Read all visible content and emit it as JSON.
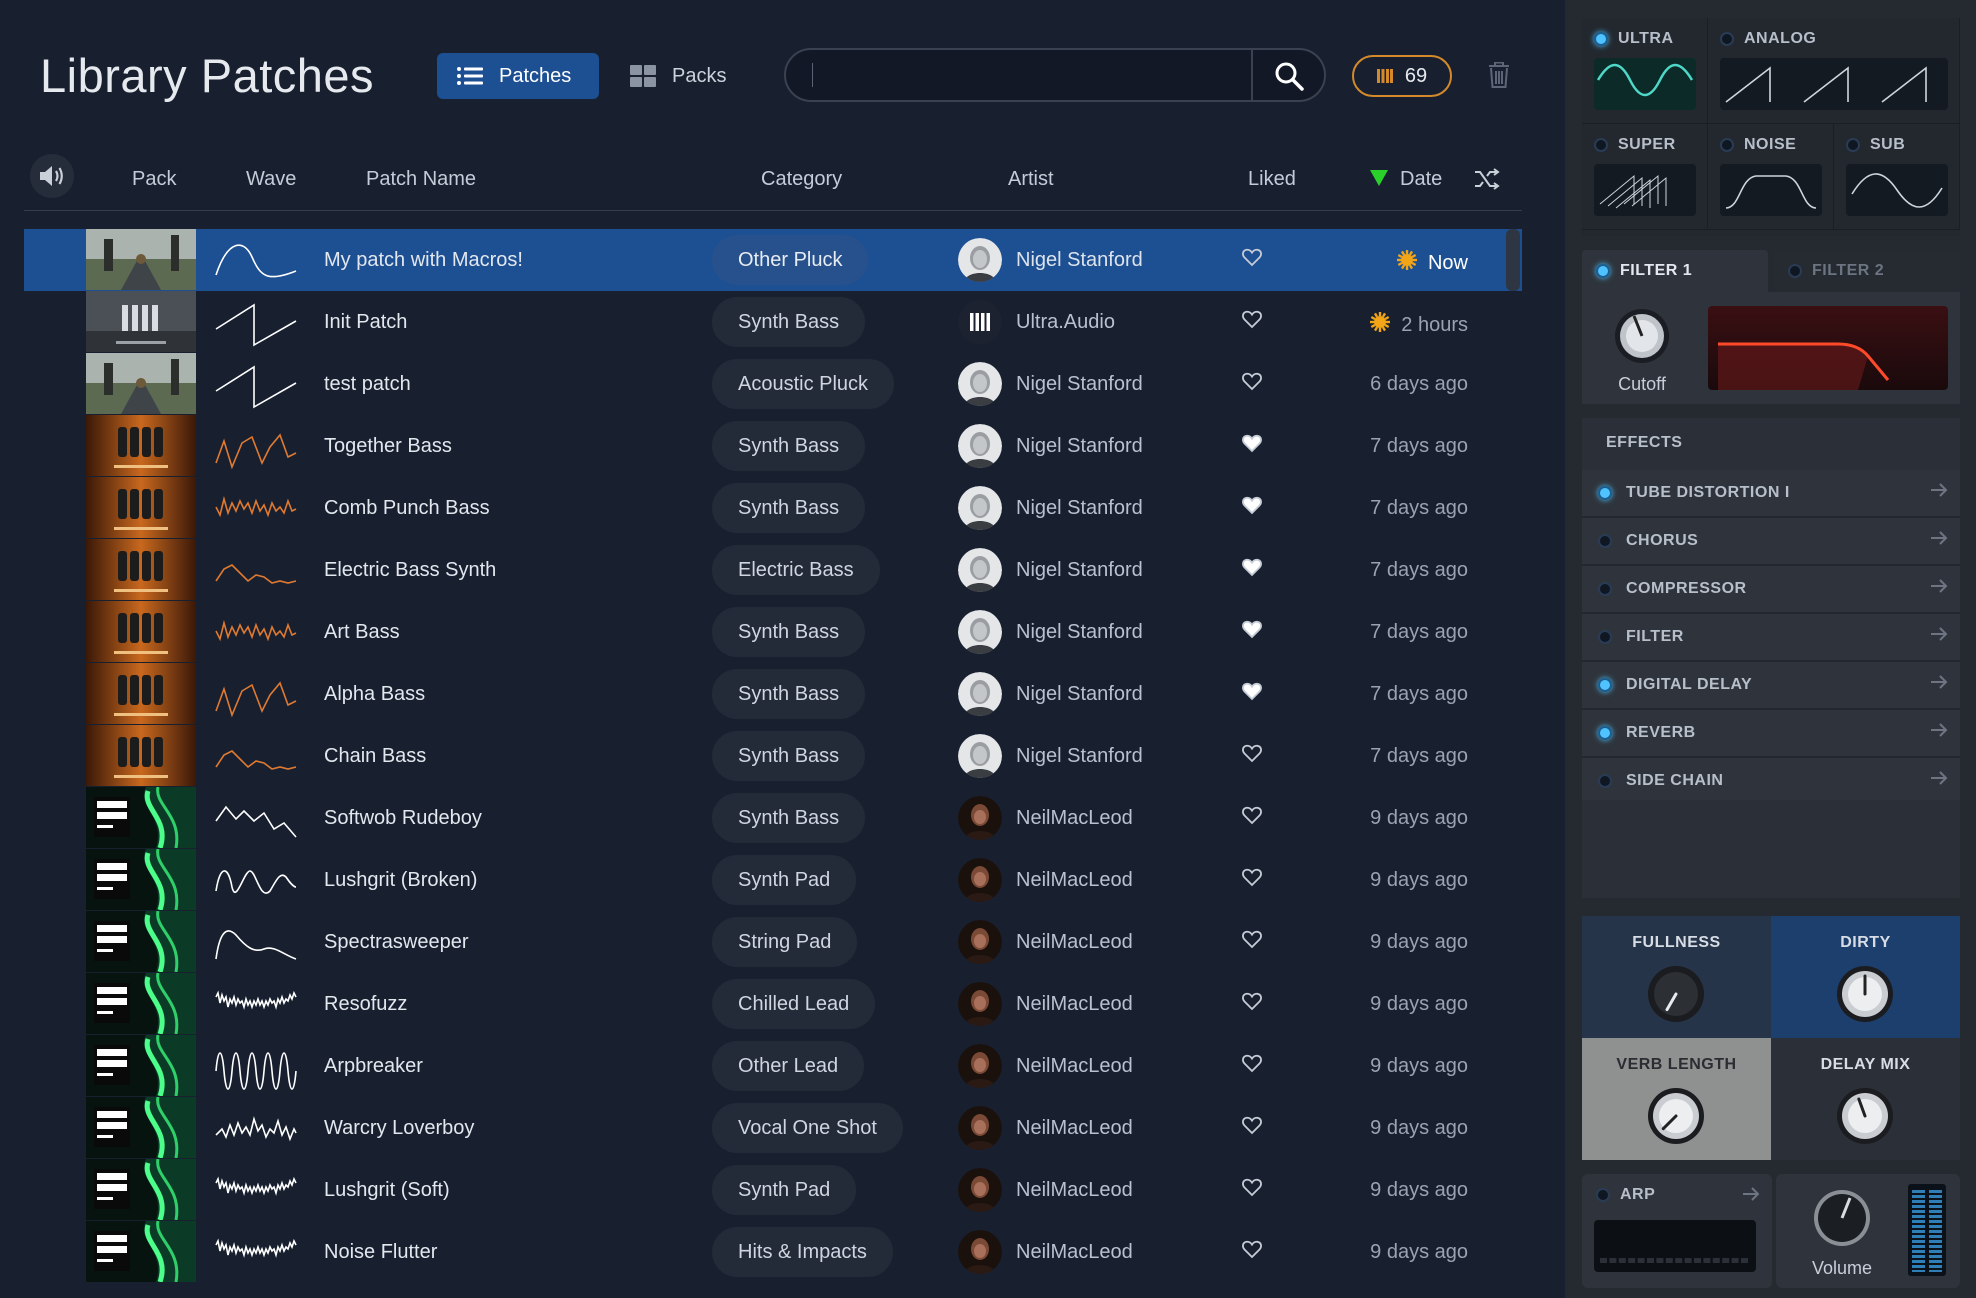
{
  "header": {
    "title": "Library Patches",
    "patches_tab": "Patches",
    "packs_tab": "Packs",
    "search_placeholder": "",
    "count": "69"
  },
  "columns": {
    "pack": "Pack",
    "wave": "Wave",
    "patch_name": "Patch Name",
    "category": "Category",
    "artist": "Artist",
    "liked": "Liked",
    "date": "Date"
  },
  "rows": [
    {
      "name": "My patch with Macros!",
      "category": "Other Pluck",
      "artist": "Nigel Stanford",
      "date": "Now",
      "liked": false,
      "recent": true,
      "pack": "road",
      "wave": "sine"
    },
    {
      "name": "Init Patch",
      "category": "Synth Bass",
      "artist": "Ultra.Audio",
      "date": "2 hours",
      "liked": false,
      "recent": true,
      "pack": "factory",
      "wave": "saw"
    },
    {
      "name": "test patch",
      "category": "Acoustic Pluck",
      "artist": "Nigel Stanford",
      "date": "6 days ago",
      "liked": false,
      "recent": false,
      "pack": "road",
      "wave": "saw"
    },
    {
      "name": "Together Bass",
      "category": "Synth Bass",
      "artist": "Nigel Stanford",
      "date": "7 days ago",
      "liked": true,
      "recent": false,
      "pack": "bass",
      "wave": "orange1"
    },
    {
      "name": "Comb Punch Bass",
      "category": "Synth Bass",
      "artist": "Nigel Stanford",
      "date": "7 days ago",
      "liked": true,
      "recent": false,
      "pack": "bass",
      "wave": "orange2"
    },
    {
      "name": "Electric Bass Synth",
      "category": "Electric Bass",
      "artist": "Nigel Stanford",
      "date": "7 days ago",
      "liked": true,
      "recent": false,
      "pack": "bass",
      "wave": "orange3"
    },
    {
      "name": "Art Bass",
      "category": "Synth Bass",
      "artist": "Nigel Stanford",
      "date": "7 days ago",
      "liked": true,
      "recent": false,
      "pack": "bass",
      "wave": "orange2"
    },
    {
      "name": "Alpha Bass",
      "category": "Synth Bass",
      "artist": "Nigel Stanford",
      "date": "7 days ago",
      "liked": true,
      "recent": false,
      "pack": "bass",
      "wave": "orange1"
    },
    {
      "name": "Chain Bass",
      "category": "Synth Bass",
      "artist": "Nigel Stanford",
      "date": "7 days ago",
      "liked": false,
      "recent": false,
      "pack": "bass",
      "wave": "orange3"
    },
    {
      "name": "Softwob Rudeboy",
      "category": "Synth Bass",
      "artist": "NeilMacLeod",
      "date": "9 days ago",
      "liked": false,
      "recent": false,
      "pack": "lush",
      "wave": "white1"
    },
    {
      "name": "Lushgrit (Broken)",
      "category": "Synth Pad",
      "artist": "NeilMacLeod",
      "date": "9 days ago",
      "liked": false,
      "recent": false,
      "pack": "lush",
      "wave": "white2"
    },
    {
      "name": "Spectrasweeper",
      "category": "String Pad",
      "artist": "NeilMacLeod",
      "date": "9 days ago",
      "liked": false,
      "recent": false,
      "pack": "lush",
      "wave": "white3"
    },
    {
      "name": "Resofuzz",
      "category": "Chilled Lead",
      "artist": "NeilMacLeod",
      "date": "9 days ago",
      "liked": false,
      "recent": false,
      "pack": "lush",
      "wave": "white4"
    },
    {
      "name": "Arpbreaker",
      "category": "Other Lead",
      "artist": "NeilMacLeod",
      "date": "9 days ago",
      "liked": false,
      "recent": false,
      "pack": "lush",
      "wave": "white5"
    },
    {
      "name": "Warcry Loverboy",
      "category": "Vocal One Shot",
      "artist": "NeilMacLeod",
      "date": "9 days ago",
      "liked": false,
      "recent": false,
      "pack": "lush",
      "wave": "white6"
    },
    {
      "name": "Lushgrit (Soft)",
      "category": "Synth Pad",
      "artist": "NeilMacLeod",
      "date": "9 days ago",
      "liked": false,
      "recent": false,
      "pack": "lush",
      "wave": "white4"
    },
    {
      "name": "Noise Flutter",
      "category": "Hits & Impacts",
      "artist": "NeilMacLeod",
      "date": "9 days ago",
      "liked": false,
      "recent": false,
      "pack": "lush",
      "wave": "white4"
    }
  ],
  "oscillators": [
    {
      "label": "ULTRA",
      "on": true
    },
    {
      "label": "ANALOG",
      "on": false
    },
    {
      "label": "SUPER",
      "on": false
    },
    {
      "label": "NOISE",
      "on": false
    },
    {
      "label": "SUB",
      "on": false
    }
  ],
  "filter": {
    "tab1": "FILTER 1",
    "tab2": "FILTER 2",
    "knob_label": "Cutoff"
  },
  "effects": {
    "title": "EFFECTS",
    "items": [
      {
        "label": "TUBE DISTORTION I",
        "on": true
      },
      {
        "label": "CHORUS",
        "on": false
      },
      {
        "label": "COMPRESSOR",
        "on": false
      },
      {
        "label": "FILTER",
        "on": false
      },
      {
        "label": "DIGITAL DELAY",
        "on": true
      },
      {
        "label": "REVERB",
        "on": true
      },
      {
        "label": "SIDE CHAIN",
        "on": false
      }
    ]
  },
  "macros": [
    {
      "label": "FULLNESS"
    },
    {
      "label": "DIRTY"
    },
    {
      "label": "VERB LENGTH"
    },
    {
      "label": "DELAY MIX"
    }
  ],
  "arp": {
    "label": "ARP"
  },
  "volume": {
    "label": "Volume"
  },
  "colors": {
    "accent": "#1d4f93",
    "orange": "#d48a2b",
    "led": "#4fc3ff"
  }
}
